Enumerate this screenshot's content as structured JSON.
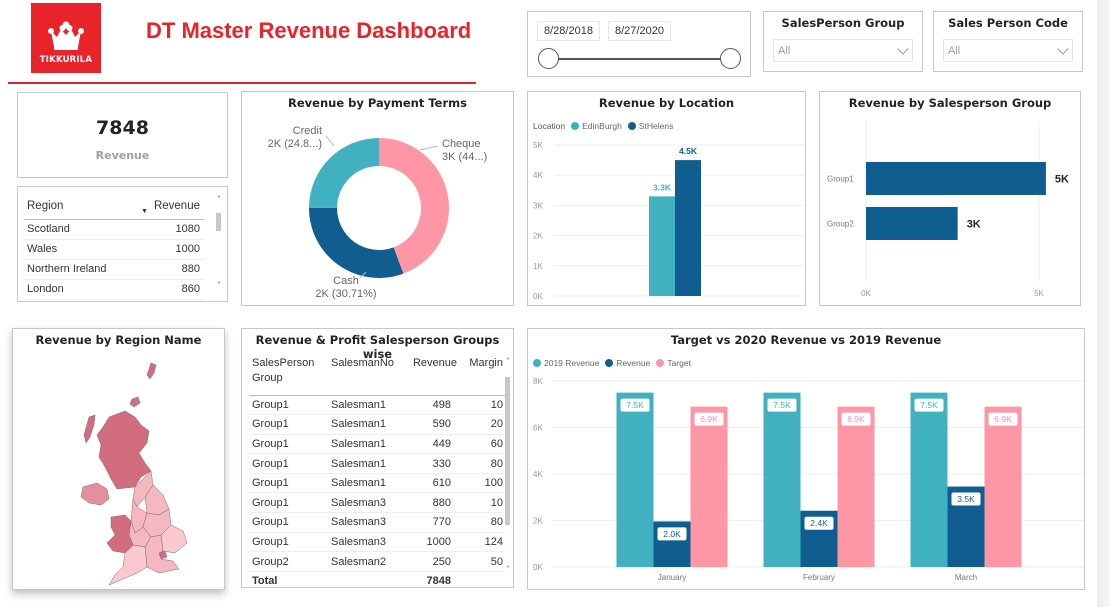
{
  "header": {
    "logo_text": "TIKKURILA",
    "title": "DT Master Revenue Dashboard",
    "brand_color": "#e8232a"
  },
  "date_slicer": {
    "start_date": "8/28/2018",
    "end_date": "8/27/2020",
    "range_fraction": [
      0,
      1
    ]
  },
  "filters": {
    "salesperson_group": {
      "title": "SalesPerson Group",
      "value": "All"
    },
    "salesperson_code": {
      "title": "Sales Person Code",
      "value": "All"
    }
  },
  "kpi": {
    "value": "7848",
    "label": "Revenue"
  },
  "region_table": {
    "headers": [
      "Region",
      "Revenue"
    ],
    "sort_indicator": "▼",
    "rows": [
      [
        "Scotland",
        "1080"
      ],
      [
        "Wales",
        "1000"
      ],
      [
        "Northern Ireland",
        "880"
      ],
      [
        "London",
        "860"
      ]
    ]
  },
  "profit_table": {
    "title": "Revenue & Profit Salesperson Groups wise",
    "headers": [
      "SalesPerson Group",
      "SalesmanNo",
      "Revenue",
      "Margin"
    ],
    "rows": [
      [
        "Group1",
        "Salesman1",
        "498",
        "10"
      ],
      [
        "Group1",
        "Salesman1",
        "590",
        "20"
      ],
      [
        "Group1",
        "Salesman1",
        "449",
        "60"
      ],
      [
        "Group1",
        "Salesman1",
        "330",
        "80"
      ],
      [
        "Group1",
        "Salesman1",
        "610",
        "100"
      ],
      [
        "Group1",
        "Salesman3",
        "880",
        "10"
      ],
      [
        "Group1",
        "Salesman3",
        "770",
        "80"
      ],
      [
        "Group1",
        "Salesman3",
        "1000",
        "124"
      ],
      [
        "Group2",
        "Salesman2",
        "250",
        "50"
      ]
    ],
    "total": {
      "label": "Total",
      "revenue": "7848"
    }
  },
  "map": {
    "title": "Revenue by Region Name",
    "colors": {
      "high": "#d16d7c",
      "mid": "#e1909c",
      "low": "#f5b7c0",
      "lowest": "#f9c9cf"
    }
  },
  "chart_data": [
    {
      "id": "payment_terms",
      "type": "pie",
      "donut": true,
      "title": "Revenue by Payment Terms",
      "slices": [
        {
          "name": "Cheque",
          "value": 3480,
          "label": "Cheque",
          "sublabel": "3K (44...)",
          "color": "#fe96a6"
        },
        {
          "name": "Cash",
          "value": 2410,
          "label": "Cash",
          "sublabel": "2K (30.71%)",
          "color": "#0f5e8f"
        },
        {
          "name": "Credit",
          "value": 1958,
          "label": "Credit",
          "sublabel": "2K (24.8...)",
          "color": "#41b1c2"
        }
      ]
    },
    {
      "id": "location",
      "type": "bar",
      "title": "Revenue by Location",
      "legend_title": "Location",
      "legend_position": "top-left",
      "categories": [
        ""
      ],
      "series": [
        {
          "name": "EdinBurgh",
          "values": [
            3300
          ],
          "label": "3.3K",
          "color": "#41b1c2"
        },
        {
          "name": "StHelens",
          "values": [
            4500
          ],
          "label": "4.5K",
          "color": "#0f5e8f"
        }
      ],
      "yticks": [
        "0K",
        "1K",
        "2K",
        "3K",
        "4K",
        "5K"
      ],
      "ylim": [
        0,
        5000
      ],
      "grid": true
    },
    {
      "id": "salesperson_group",
      "type": "bar",
      "orientation": "horizontal",
      "title": "Revenue by Salesperson Group",
      "categories": [
        "Group1",
        "Group2"
      ],
      "values": [
        5200,
        2650
      ],
      "labels": [
        "5K",
        "3K"
      ],
      "color": "#0f5e8f",
      "xticks": [
        "0K",
        "5K"
      ],
      "xlim": [
        0,
        5000
      ],
      "grid": true
    },
    {
      "id": "target_vs_revenue",
      "type": "bar",
      "title": "Target vs 2020 Revenue vs 2019 Revenue",
      "legend_position": "top-left",
      "categories": [
        "January",
        "February",
        "March"
      ],
      "series": [
        {
          "name": "2019 Revenue",
          "values": [
            7500,
            7500,
            7500
          ],
          "labels": [
            "7.5K",
            "7.5K",
            "7.5K"
          ],
          "color": "#41b1c2"
        },
        {
          "name": "Revenue",
          "values": [
            1960,
            2420,
            3460
          ],
          "labels": [
            "2.0K",
            "2.4K",
            "3.5K"
          ],
          "color": "#0f5e8f"
        },
        {
          "name": "Target",
          "values": [
            6900,
            6900,
            6900
          ],
          "labels": [
            "6.9K",
            "6.9K",
            "6.9K"
          ],
          "color": "#fe96a6"
        }
      ],
      "yticks": [
        "0K",
        "2K",
        "4K",
        "6K",
        "8K"
      ],
      "ylim": [
        0,
        8000
      ],
      "grid": true
    }
  ]
}
